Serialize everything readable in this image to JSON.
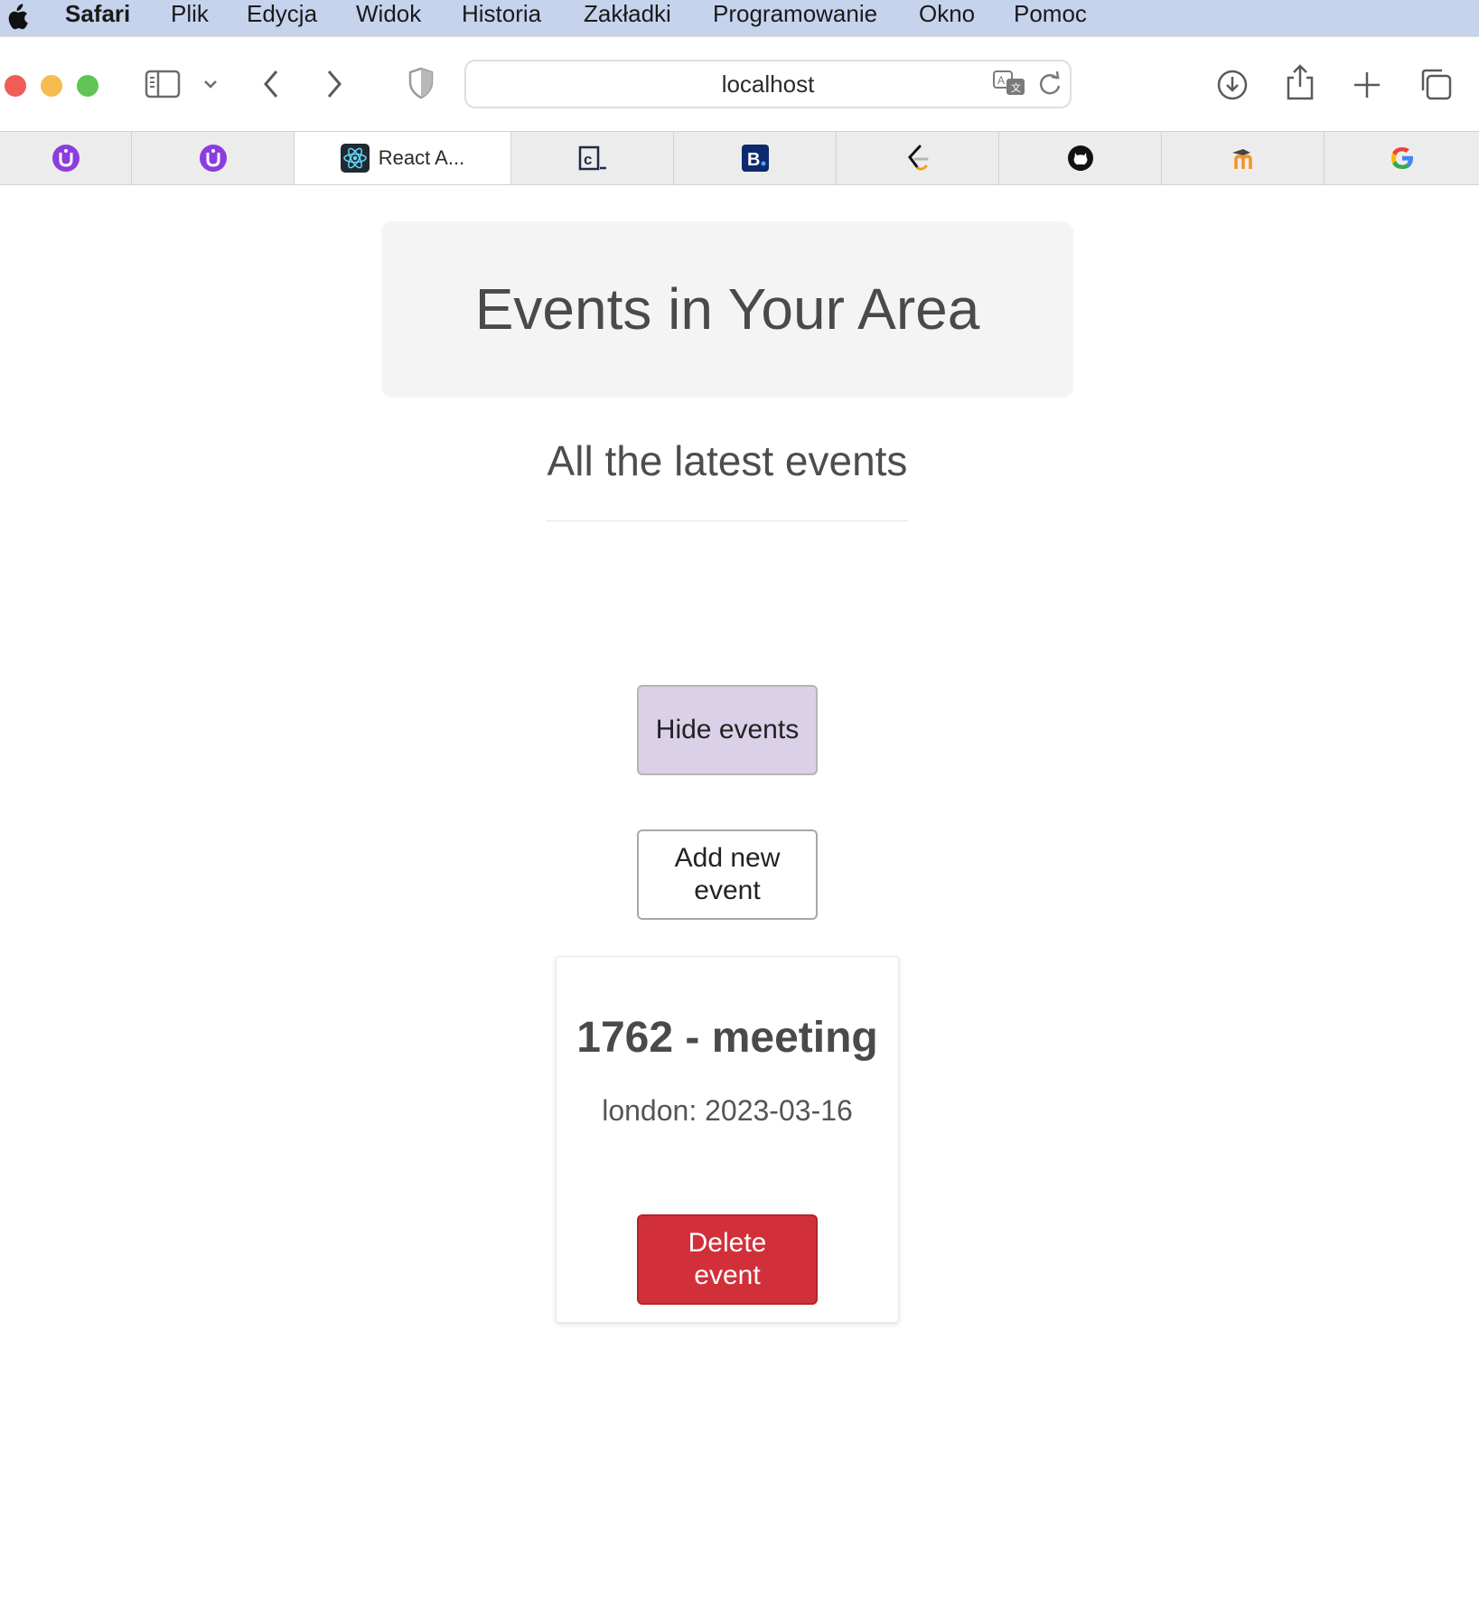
{
  "menubar": {
    "app_name": "Safari",
    "items": [
      "Plik",
      "Edycja",
      "Widok",
      "Historia",
      "Zakładki",
      "Programowanie",
      "Okno",
      "Pomoc"
    ]
  },
  "toolbar": {
    "url": "localhost"
  },
  "tabs": [
    {
      "icon": "purple-u-icon"
    },
    {
      "icon": "purple-u-icon"
    },
    {
      "icon": "react-icon",
      "title": "React A..."
    },
    {
      "icon": "codecademy-icon"
    },
    {
      "icon": "booking-icon"
    },
    {
      "icon": "leetcode-icon"
    },
    {
      "icon": "github-icon"
    },
    {
      "icon": "moodle-icon"
    },
    {
      "icon": "google-icon"
    }
  ],
  "page": {
    "hero_title": "Events in Your Area",
    "subtitle": "All the latest events",
    "hide_button": "Hide events",
    "add_button": "Add new event",
    "event": {
      "title": "1762 - meeting",
      "info": "london: 2023-03-16",
      "delete_button": "Delete event"
    }
  },
  "colors": {
    "hide_button_bg": "#dad0e8",
    "delete_button_bg": "#d1303a",
    "hero_bg": "#f4f4f4",
    "menubar_bg": "#c6d3ec"
  }
}
